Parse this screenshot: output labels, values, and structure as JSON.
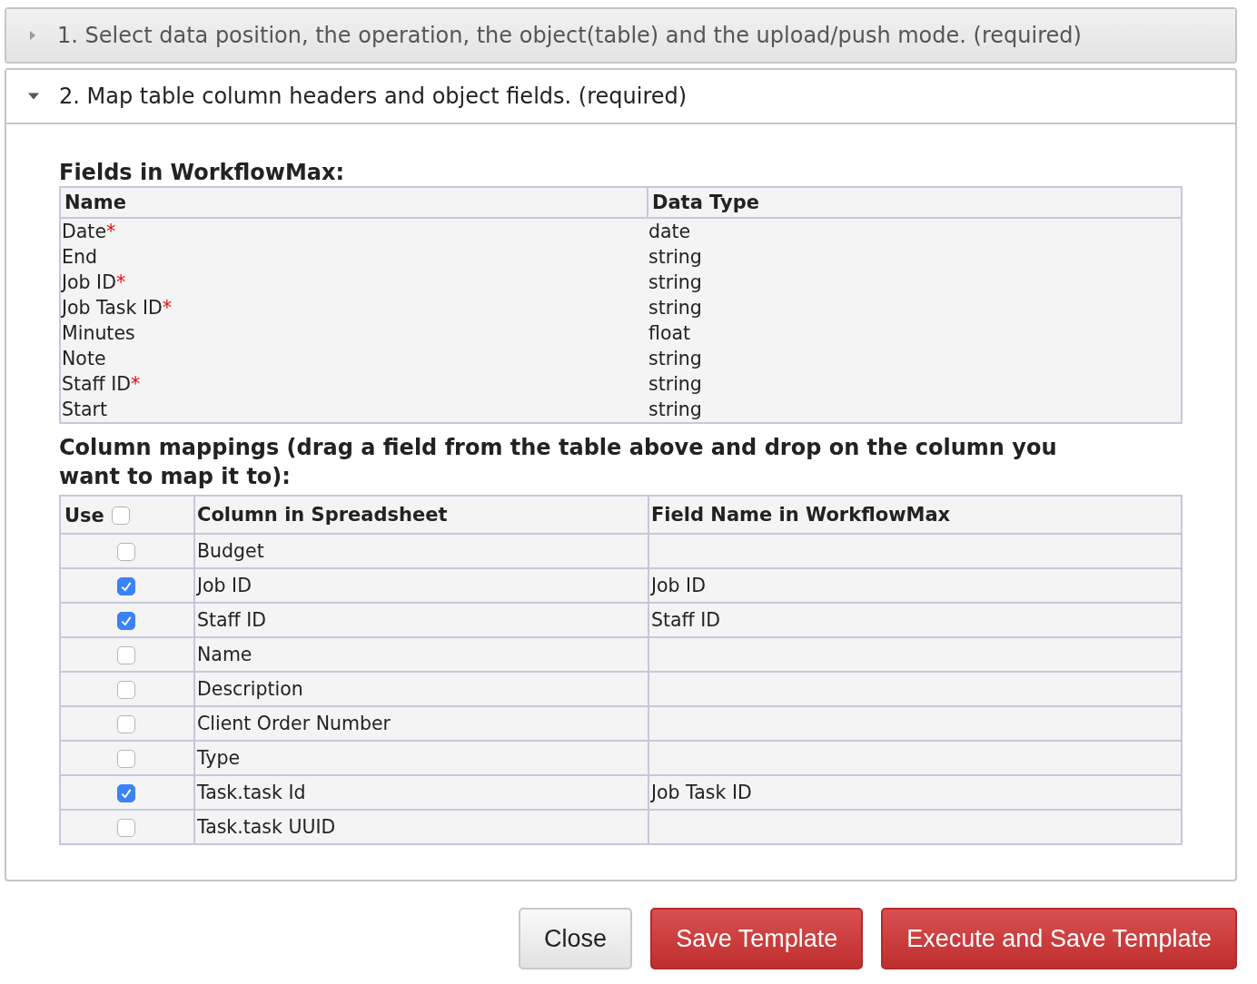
{
  "sections": [
    {
      "title": "1. Select data position, the operation, the object(table) and the upload/push mode. (required)",
      "expanded": false
    },
    {
      "title": "2. Map table column headers and object fields. (required)",
      "expanded": true
    }
  ],
  "fields_heading": "Fields in WorkflowMax:",
  "fields_table": {
    "columns": [
      "Name",
      "Data Type"
    ],
    "rows": [
      {
        "name": "Date*",
        "required": true,
        "type": "date"
      },
      {
        "name": "End",
        "required": false,
        "type": "string"
      },
      {
        "name": "Job ID*",
        "required": true,
        "type": "string"
      },
      {
        "name": "Job Task ID*",
        "required": true,
        "type": "string"
      },
      {
        "name": "Minutes",
        "required": false,
        "type": "float"
      },
      {
        "name": "Note",
        "required": false,
        "type": "string"
      },
      {
        "name": "Staff ID*",
        "required": true,
        "type": "string"
      },
      {
        "name": "Start",
        "required": false,
        "type": "string"
      }
    ]
  },
  "mappings_heading": "Column mappings (drag a field from the table above and drop on the column you want to map it to):",
  "mappings_table": {
    "columns": [
      {
        "label": "Use",
        "checked": false
      },
      {
        "label": "Column in Spreadsheet"
      },
      {
        "label": "Field Name in WorkflowMax"
      }
    ],
    "rows": [
      {
        "checked": false,
        "column": "Budget"
      },
      {
        "checked": true,
        "column": "Job ID",
        "field": "Job ID"
      },
      {
        "checked": true,
        "column": "Staff ID",
        "field": "Staff ID"
      },
      {
        "checked": false,
        "column": "Name"
      },
      {
        "checked": false,
        "column": "Description"
      },
      {
        "checked": false,
        "column": "Client Order Number"
      },
      {
        "checked": false,
        "column": "Type"
      },
      {
        "checked": true,
        "column": "Task.task Id",
        "field": "Job Task ID"
      },
      {
        "checked": false,
        "column": "Task.task UUID"
      }
    ]
  },
  "buttons": [
    {
      "label": "Close",
      "kind": "default"
    },
    {
      "label": "Save Template",
      "kind": "primary"
    },
    {
      "label": "Execute and Save Template",
      "kind": "primary"
    }
  ]
}
